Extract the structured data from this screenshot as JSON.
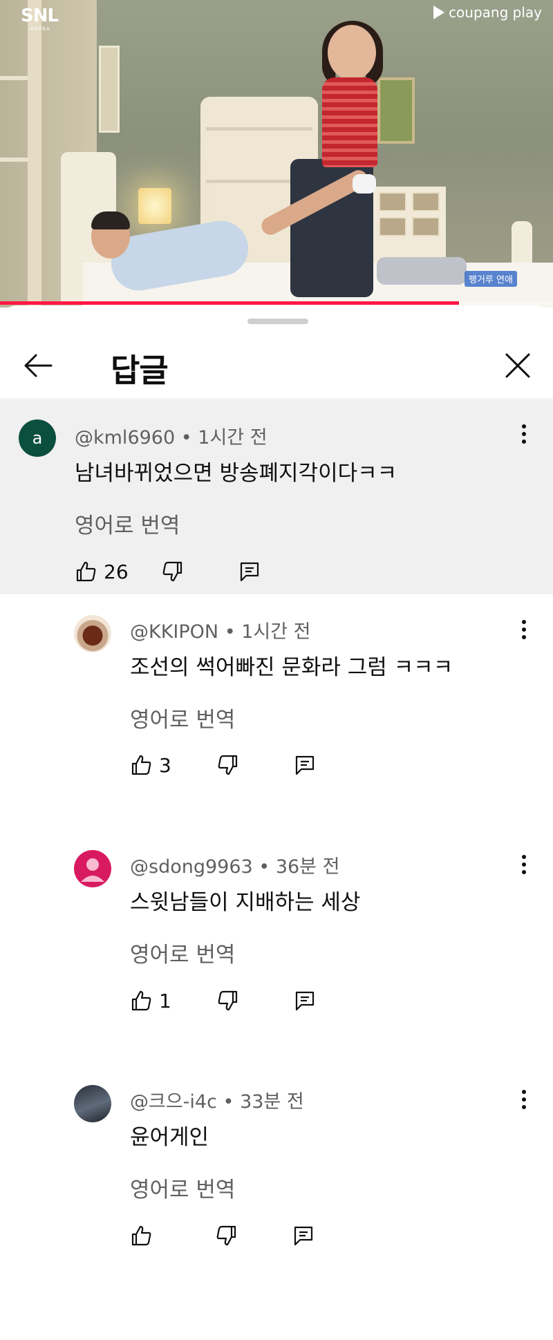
{
  "video": {
    "channel_logo": "SNL",
    "channel_logo_sub": "KOREA",
    "provider": "coupang play",
    "caption_badge": "팽거루 연애",
    "progress_fraction": 0.83,
    "progress_color": "#ff1744"
  },
  "sheet": {
    "title": "답글",
    "back_icon": "arrow-left-icon",
    "close_icon": "close-icon"
  },
  "comments": [
    {
      "handle": "@kml6960",
      "time": "1시간 전",
      "avatar_letter": "a",
      "avatar_color": "#0b4f3e",
      "text": "남녀바뀌었으면 방송폐지각이다ㅋㅋ",
      "translate": "영어로 번역",
      "likes": "26"
    },
    {
      "handle": "@KKIPON",
      "time": "1시간 전",
      "text": "조선의 썩어빠진 문화라 그럼 ㅋㅋㅋ",
      "translate": "영어로 번역",
      "likes": "3"
    },
    {
      "handle": "@sdong9963",
      "time": "36분 전",
      "avatar_color": "#d81b60",
      "text": "스윗남들이 지배하는 세상",
      "translate": "영어로 번역",
      "likes": "1"
    },
    {
      "handle": "@크으-i4c",
      "time": "33분 전",
      "text": "윤어게인",
      "translate": "영어로 번역",
      "likes": ""
    }
  ],
  "icons": {
    "like": "thumbs-up-icon",
    "dislike": "thumbs-down-icon",
    "reply": "reply-icon",
    "more": "more-vertical-icon"
  }
}
